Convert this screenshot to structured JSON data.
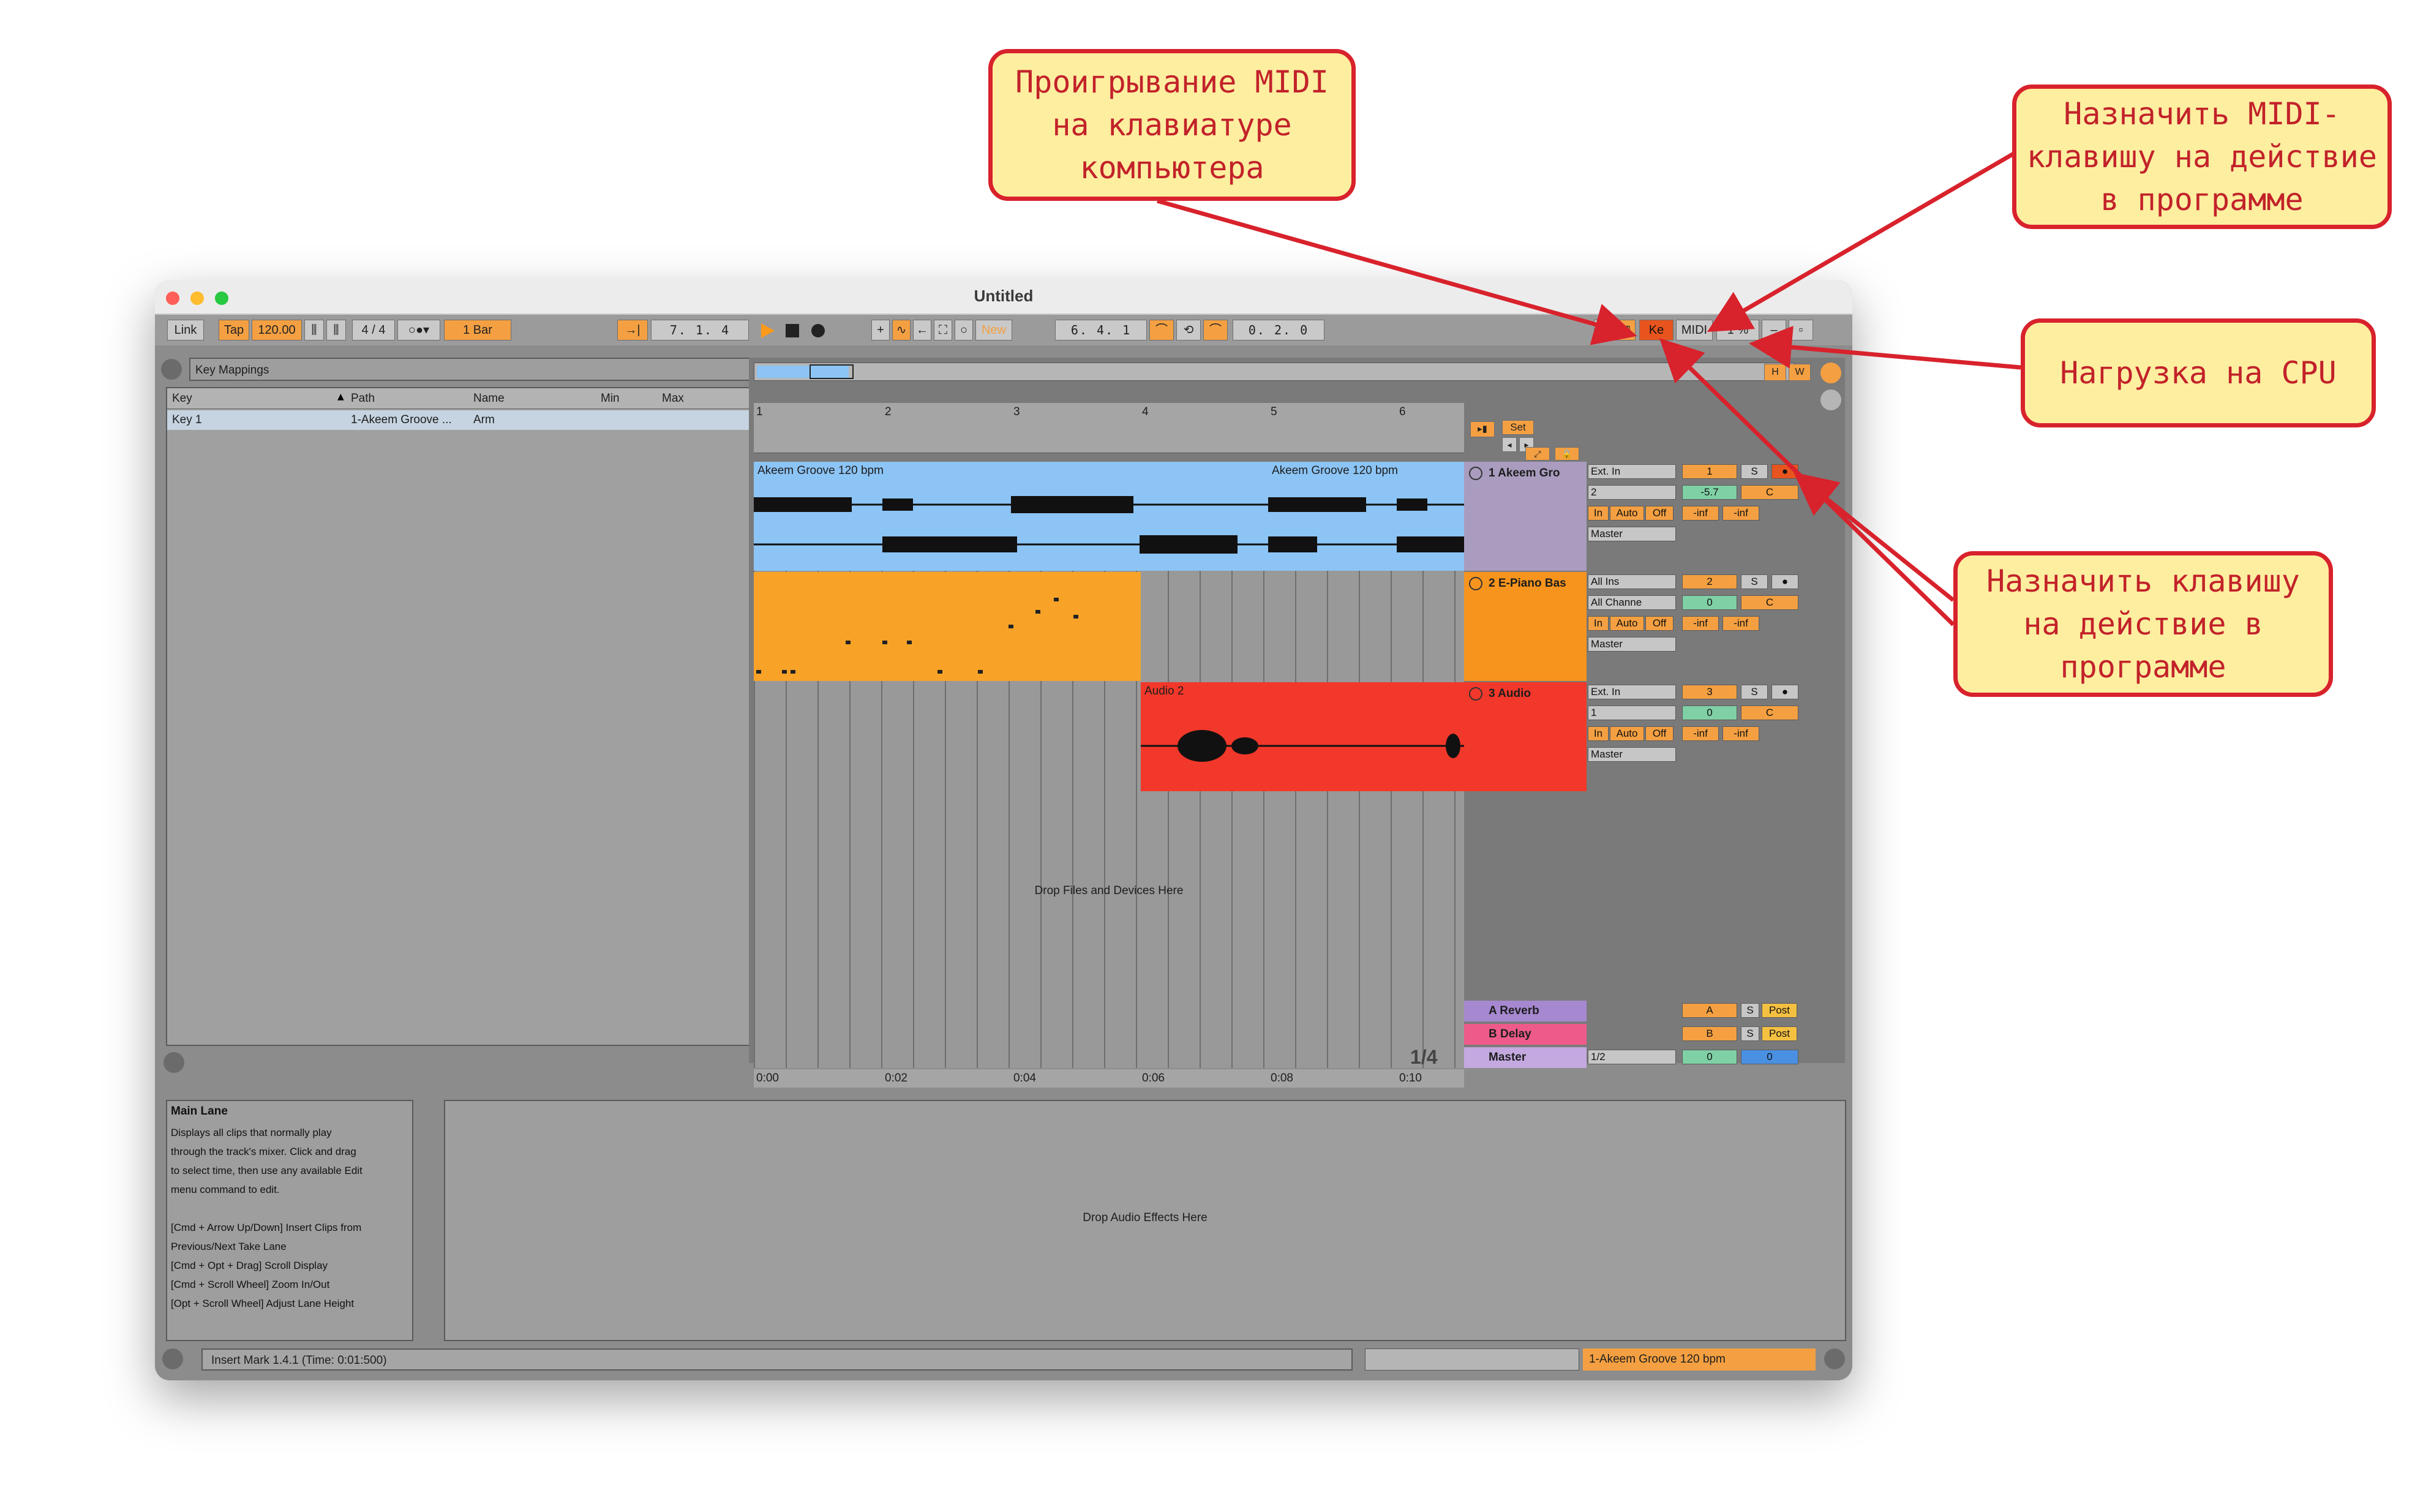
{
  "window": {
    "title": "Untitled"
  },
  "controlbar": {
    "link": "Link",
    "tap": "Tap",
    "tempo": "120.00",
    "time_sig": "4 / 4",
    "quantize": "1 Bar",
    "position": "7.   1.   4",
    "new_label": "New",
    "loop_start": "6.   4.   1",
    "loop_length": "0.   2.   0",
    "key_label": "Ke",
    "midi_label": "MIDI",
    "cpu_label": "1 %"
  },
  "browser": {
    "title": "Key Mappings",
    "columns": [
      "Key",
      "Path",
      "Name",
      "Min",
      "Max"
    ],
    "rows": [
      {
        "key": "Key 1",
        "path": "1-Akeem Groove ...",
        "name": "Arm",
        "min": "",
        "max": ""
      }
    ]
  },
  "arrangement": {
    "bars": [
      "1",
      "2",
      "3",
      "4",
      "5",
      "6"
    ],
    "set_label": "Set",
    "times": [
      "0:00",
      "0:02",
      "0:04",
      "0:06",
      "0:08",
      "0:10"
    ],
    "zoom": "1/4",
    "drop_label": "Drop Files and Devices Here",
    "clips": {
      "audio1_a": "Akeem Groove 120 bpm",
      "audio1_b": "Akeem Groove 120 bpm",
      "audio2": "Audio 2"
    }
  },
  "tracks": [
    {
      "name": "1 Akeem Gro",
      "input": "Ext. In",
      "channel": "2",
      "in": "In",
      "auto": "Auto",
      "off": "Off",
      "output": "Master",
      "number": "1",
      "solo": "S",
      "volume": "-5.7",
      "pan": "C",
      "meter_l": "-inf",
      "meter_r": "-inf",
      "color": "#a99cbf"
    },
    {
      "name": "2 E-Piano Bas",
      "input": "All Ins",
      "channel": "All Channe",
      "in": "In",
      "auto": "Auto",
      "off": "Off",
      "output": "Master",
      "number": "2",
      "solo": "S",
      "volume": "0",
      "pan": "C",
      "meter_l": "-inf",
      "meter_r": "-inf",
      "color": "#f7941e"
    },
    {
      "name": "3 Audio",
      "input": "Ext. In",
      "channel": "1",
      "in": "In",
      "auto": "Auto",
      "off": "Off",
      "output": "Master",
      "number": "3",
      "solo": "S",
      "volume": "0",
      "pan": "C",
      "meter_l": "-inf",
      "meter_r": "-inf",
      "color": "#f2382a"
    }
  ],
  "returns": [
    {
      "name": "A Reverb",
      "letter": "A",
      "solo": "S",
      "post": "Post"
    },
    {
      "name": "B Delay",
      "letter": "B",
      "solo": "S",
      "post": "Post"
    }
  ],
  "master": {
    "name": "Master",
    "output": "1/2",
    "volume": "0",
    "pan": "0"
  },
  "info": {
    "title": "Main Lane",
    "lines": [
      "Displays all clips that normally play",
      "through the track's mixer. Click and drag",
      "to select time, then use any available Edit",
      "menu command to edit.",
      "",
      "[Cmd + Arrow Up/Down] Insert Clips from",
      "Previous/Next Take Lane",
      "[Cmd + Opt + Drag] Scroll Display",
      "[Cmd + Scroll Wheel] Zoom In/Out",
      "[Opt + Scroll Wheel] Adjust Lane Height"
    ]
  },
  "device": {
    "drop_label": "Drop Audio Effects Here"
  },
  "status": {
    "text": "Insert Mark 1.4.1 (Time: 0:01:500)",
    "clip_name": "1-Akeem Groove 120 bpm"
  },
  "callouts": {
    "midi_keyboard": [
      "Проигрывание MIDI",
      "на клавиатуре",
      "компьютера"
    ],
    "midi_map": [
      "Назначить MIDI-",
      "клавишу на действие",
      "в программе"
    ],
    "cpu": [
      "Нагрузка на CPU"
    ],
    "key_map": [
      "Назначить клавишу",
      "на действие в",
      "программе"
    ]
  },
  "colors": {
    "accent": "#f4a042",
    "callout_border": "#d8222c",
    "callout_fill": "#fdeea0",
    "clip_blue": "#8cc4f5",
    "clip_orange": "#f8a328",
    "clip_red": "#f2382a"
  }
}
